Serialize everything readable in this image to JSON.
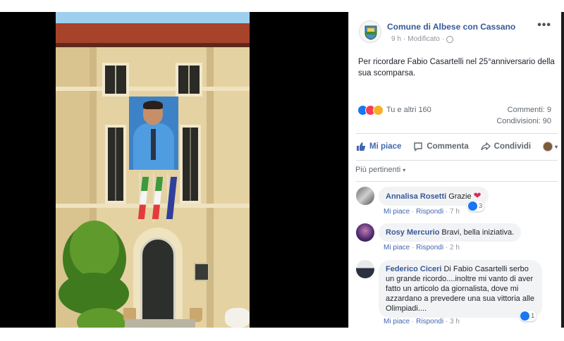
{
  "post": {
    "page_name": "Comune di Albese con Cassano",
    "time": "9 h",
    "edited": "Modificato",
    "meta_separator": "·",
    "menu_glyph": "•••",
    "text": "Per ricordare Fabio Casartelli nel 25°anniversario della sua scomparsa.",
    "reactions_summary": "Tu e altri 160",
    "comments_count": "Commenti: 9",
    "shares_count": "Condivisioni: 90"
  },
  "actions": {
    "like": "Mi piace",
    "comment": "Commenta",
    "share": "Condividi"
  },
  "sort": {
    "label": "Più pertinenti",
    "caret": "▾"
  },
  "comments": [
    {
      "author": "Annalisa Rosetti",
      "text": "Grazie",
      "like": "Mi piace",
      "reply": "Rispondi",
      "time": "7 h",
      "reaction_count": "3"
    },
    {
      "author": "Rosy Mercurio",
      "text": "Bravi, bella iniziativa.",
      "like": "Mi piace",
      "reply": "Rispondi",
      "time": "2 h"
    },
    {
      "author": "Federico Ciceri",
      "text": "Di Fabio Casartelli serbo un grande ricordo....inoltre mi vanto di aver fatto un articolo da giornalista, dove mi azzardano a prevedere una sua vittoria alle Olimpiadi....",
      "like": "Mi piace",
      "reply": "Rispondi",
      "time": "3 h",
      "reaction_count": "1"
    }
  ],
  "colors": {
    "link": "#385898",
    "accent": "#4267b2",
    "muted": "#606770",
    "bubble": "#f2f3f5"
  },
  "icons": [
    "page-logo-icon",
    "globe-icon",
    "more-icon",
    "like-reaction-icon",
    "love-reaction-icon",
    "haha-reaction-icon",
    "thumbs-up-icon",
    "comment-icon",
    "share-icon",
    "heart-icon"
  ]
}
